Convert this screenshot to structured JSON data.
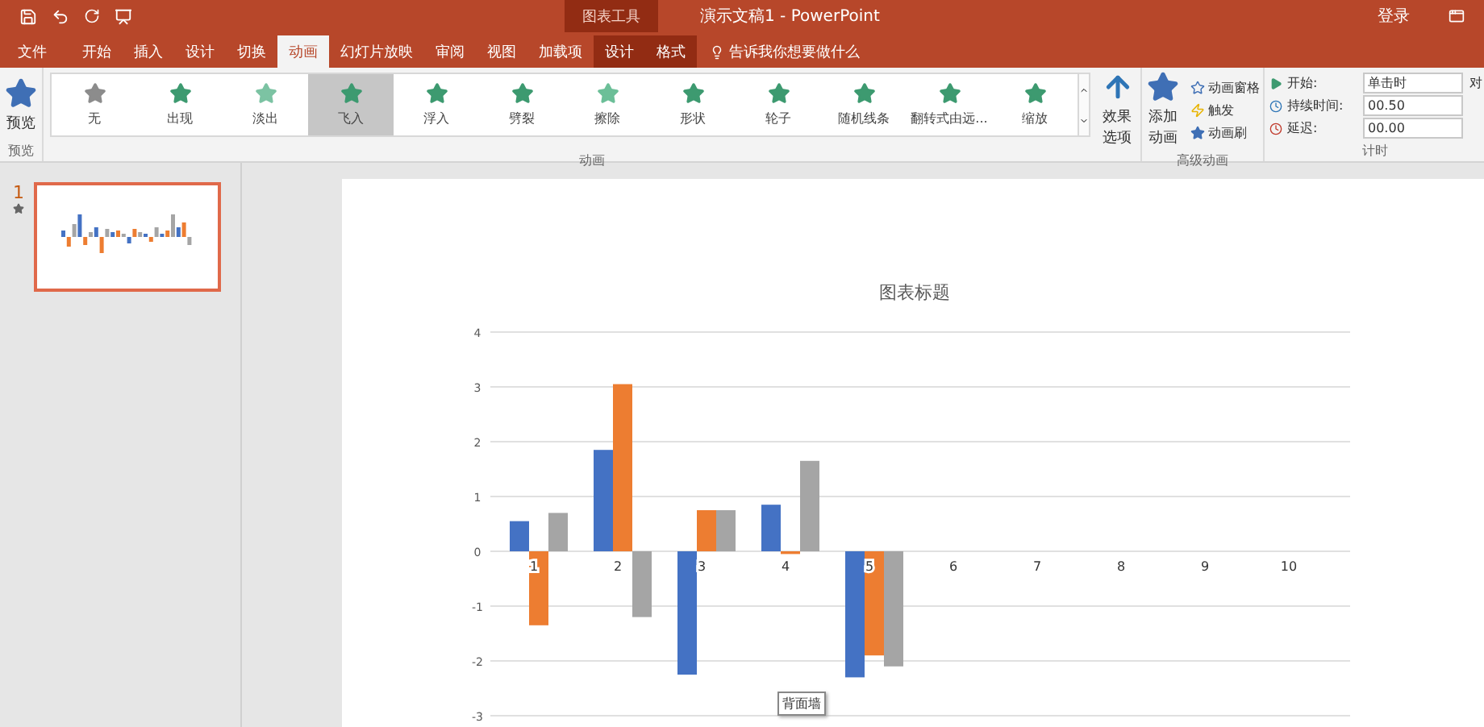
{
  "app": {
    "title": "演示文稿1 - PowerPoint",
    "context_title": "图表工具",
    "sign_in": "登录"
  },
  "tabs": [
    {
      "label": "文件",
      "selected": false,
      "context": false
    },
    {
      "label": "开始",
      "selected": false,
      "context": false
    },
    {
      "label": "插入",
      "selected": false,
      "context": false
    },
    {
      "label": "设计",
      "selected": false,
      "context": false
    },
    {
      "label": "切换",
      "selected": false,
      "context": false
    },
    {
      "label": "动画",
      "selected": true,
      "context": false
    },
    {
      "label": "幻灯片放映",
      "selected": false,
      "context": false
    },
    {
      "label": "审阅",
      "selected": false,
      "context": false
    },
    {
      "label": "视图",
      "selected": false,
      "context": false
    },
    {
      "label": "加载项",
      "selected": false,
      "context": false
    },
    {
      "label": "设计",
      "selected": false,
      "context": true
    },
    {
      "label": "格式",
      "selected": false,
      "context": true
    }
  ],
  "tell_me": "告诉我你想要做什么",
  "ribbon": {
    "preview": {
      "label": "预览",
      "group": "预览"
    },
    "gallery": {
      "group": "动画",
      "items": [
        {
          "label": "无",
          "selected": false
        },
        {
          "label": "出现",
          "selected": false
        },
        {
          "label": "淡出",
          "selected": false
        },
        {
          "label": "飞入",
          "selected": true
        },
        {
          "label": "浮入",
          "selected": false
        },
        {
          "label": "劈裂",
          "selected": false
        },
        {
          "label": "擦除",
          "selected": false
        },
        {
          "label": "形状",
          "selected": false
        },
        {
          "label": "轮子",
          "selected": false
        },
        {
          "label": "随机线条",
          "selected": false
        },
        {
          "label": "翻转式由远...",
          "selected": false
        },
        {
          "label": "缩放",
          "selected": false
        }
      ]
    },
    "effect_options": "效果选项",
    "advanced": {
      "group": "高级动画",
      "add": "添加动画",
      "pane": "动画窗格",
      "trigger": "触发",
      "painter": "动画刷"
    },
    "timing": {
      "group": "计时",
      "start_label": "开始:",
      "start_value": "单击时",
      "duration_label": "持续时间:",
      "duration_value": "00.50",
      "delay_label": "延迟:",
      "delay_value": "00.00",
      "reorder": "对"
    }
  },
  "thumbnails": [
    {
      "number": "1",
      "selected": true
    }
  ],
  "slide": {
    "tooltip": "背面墙",
    "chart_data": {
      "type": "bar",
      "title": "图表标题",
      "categories": [
        "1",
        "2",
        "3",
        "4",
        "5",
        "6",
        "7",
        "8",
        "9",
        "10"
      ],
      "ylim": [
        -3,
        4
      ],
      "yticks": [
        4,
        3,
        2,
        1,
        0,
        -1,
        -2,
        -3
      ],
      "grid": true,
      "series": [
        {
          "color": "#4472c4",
          "values": [
            0.55,
            1.85,
            -2.25,
            0.85,
            -2.3,
            null,
            null,
            null,
            null,
            null
          ]
        },
        {
          "color": "#ed7d31",
          "values": [
            -1.35,
            3.05,
            0.75,
            -0.05,
            -1.9,
            null,
            null,
            null,
            null,
            null
          ]
        },
        {
          "color": "#a5a5a5",
          "values": [
            0.7,
            -1.2,
            0.75,
            1.65,
            -2.1,
            null,
            null,
            null,
            null,
            null
          ]
        }
      ]
    }
  }
}
